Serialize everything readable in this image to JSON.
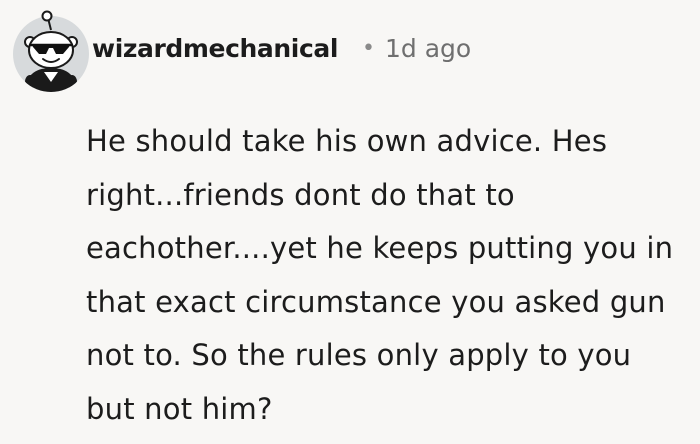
{
  "comment": {
    "author": "wizardmechanical",
    "separator": "•",
    "timestamp": "1d ago",
    "body": "He should take his own advice. Hes right...friends dont do that to eachother....yet he keeps putting you in that exact circumstance you asked gun not to. So the rules only apply to you but not him?",
    "avatar_icon": "snoo-avatar-sunglasses-icon",
    "colors": {
      "background": "#f8f7f5",
      "avatar_background": "#d7dadc",
      "text": "#1c1c1c",
      "meta_text": "#6f6f6f"
    }
  }
}
